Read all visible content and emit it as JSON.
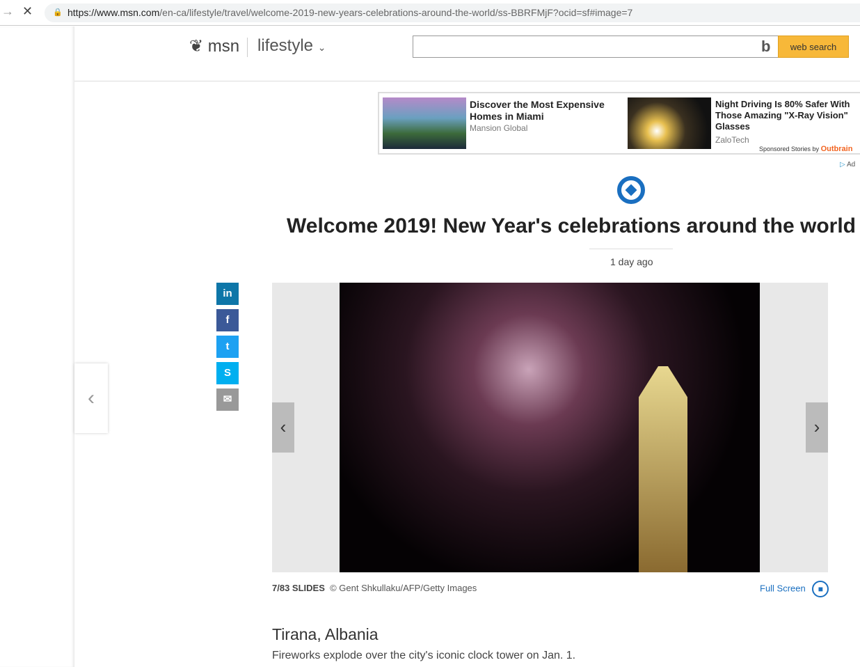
{
  "browser": {
    "url_host": "https://www.msn.com",
    "url_path": "/en-ca/lifestyle/travel/welcome-2019-new-years-celebrations-around-the-world/ss-BBRFMjF?ocid=sf#image=7"
  },
  "header": {
    "logo": "msn",
    "section": "lifestyle",
    "search_button": "web search",
    "search_placeholder": ""
  },
  "ads": [
    {
      "title": "Discover the Most Expensive Homes in Miami",
      "source": "Mansion Global"
    },
    {
      "title": "Night Driving Is 80% Safer With Those Amazing \"X-Ray Vision\" Glasses",
      "source": "ZaloTech"
    }
  ],
  "ads_footer": "Sponsored Stories by",
  "ads_brand": "Outbrain",
  "adchoices": "Ad",
  "article": {
    "title": "Welcome 2019! New Year's celebrations around the world",
    "time": "1 day ago"
  },
  "slideshow": {
    "counter": "7/83 SLIDES",
    "credit": "© Gent Shkullaku/AFP/Getty Images",
    "fullscreen": "Full Screen",
    "slide_title": "Tirana, Albania",
    "caption": "Fireworks explode over the city's iconic clock tower on Jan. 1."
  },
  "social": {
    "linkedin": "in",
    "facebook": "f",
    "twitter": "t",
    "skype": "S",
    "email": "✉"
  }
}
